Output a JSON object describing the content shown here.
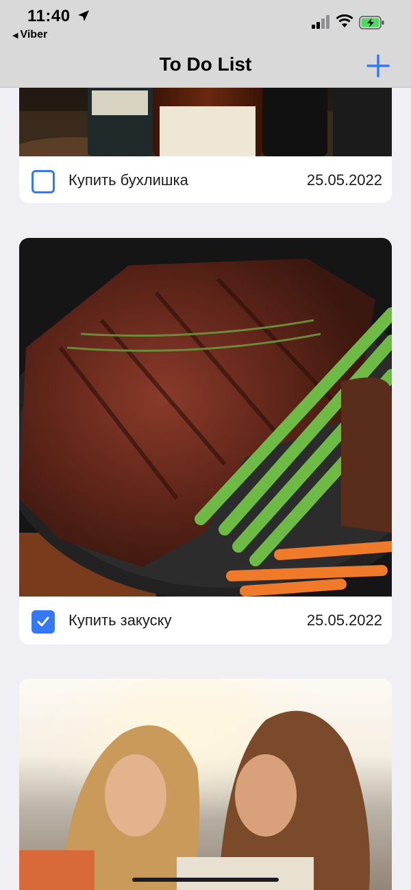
{
  "status_bar": {
    "time": "11:40",
    "back_app": "Viber",
    "icons": [
      "location-arrow-icon",
      "cellular-signal-icon",
      "wifi-icon",
      "battery-charging-icon"
    ]
  },
  "nav": {
    "title": "To Do List",
    "add_icon": "plus-icon"
  },
  "colors": {
    "accent": "#3478f6",
    "background": "#efeff4",
    "card": "#ffffff",
    "nav_bg": "#d9d9d9",
    "battery_green": "#4cd964"
  },
  "tasks": [
    {
      "title": "Купить бухлишка",
      "date": "25.05.2022",
      "checked": false,
      "image": "whisky-bottles-photo"
    },
    {
      "title": "Купить закуску",
      "date": "25.05.2022",
      "checked": true,
      "image": "steak-asparagus-photo"
    },
    {
      "title": "",
      "date": "",
      "checked": false,
      "image": "two-women-sunset-photo"
    }
  ]
}
